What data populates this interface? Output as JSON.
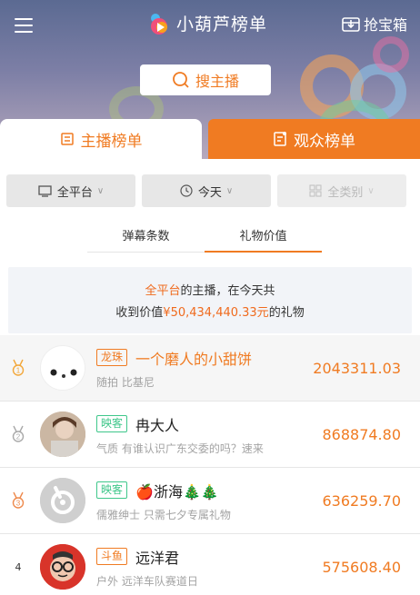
{
  "header": {
    "app_title": "小葫芦榜单",
    "treasure_label": "抢宝箱",
    "search_label": "搜主播"
  },
  "tabs": [
    {
      "label": "主播榜单",
      "active": true
    },
    {
      "label": "观众榜单",
      "active": false
    }
  ],
  "filters": [
    {
      "label": "全平台",
      "icon": "monitor-icon"
    },
    {
      "label": "今天",
      "icon": "clock-icon"
    },
    {
      "label": "全类别",
      "icon": "grid-icon",
      "disabled": true
    }
  ],
  "subtabs": [
    {
      "label": "弹幕条数",
      "active": false
    },
    {
      "label": "礼物价值",
      "active": true
    }
  ],
  "summary": {
    "platform": "全平台",
    "text_a": "的主播，在今天共",
    "text_b": "收到价值",
    "amount": "¥50,434,440.33元",
    "text_c": "的礼物"
  },
  "list": [
    {
      "rank": "1",
      "platform": "龙珠",
      "name": "一个磨人的小甜饼",
      "desc": "随拍 比基尼",
      "value": "2043311.03"
    },
    {
      "rank": "2",
      "platform": "映客",
      "name": "冉大人",
      "desc": "气质 有谁认识广东交委的吗？速来",
      "value": "868874.80"
    },
    {
      "rank": "3",
      "platform": "映客",
      "name": "🍎浙海🎄🎄",
      "desc": "儒雅绅士 只需七夕专属礼物",
      "value": "636259.70"
    },
    {
      "rank": "4",
      "platform": "斗鱼",
      "name": "远洋君",
      "desc": "户外 远洋车队赛道日",
      "value": "575608.40"
    }
  ],
  "colors": {
    "accent": "#f07b22",
    "platform_green": "#3ec78a"
  }
}
